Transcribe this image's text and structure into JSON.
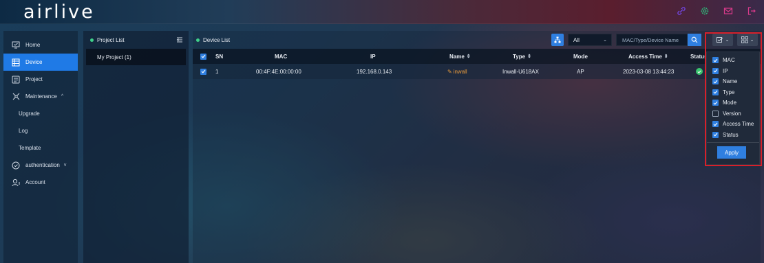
{
  "brand": {
    "logo_text": "airlive"
  },
  "topbar": {
    "icons": [
      "link-icon",
      "settings-icon",
      "mail-icon",
      "logout-icon"
    ],
    "icon_colors": {
      "link": "#7a4cff",
      "settings": "#2ec27e",
      "mail": "#d83a8a",
      "logout": "#d83a8a"
    }
  },
  "sidebar": {
    "items": [
      {
        "label": "Home",
        "icon": "monitor-icon"
      },
      {
        "label": "Device",
        "icon": "device-list-icon",
        "active": true
      },
      {
        "label": "Project",
        "icon": "project-icon"
      },
      {
        "label": "Maintenance",
        "icon": "maintenance-icon",
        "caret": "^"
      },
      {
        "label": "Upgrade"
      },
      {
        "label": "Log"
      },
      {
        "label": "Template"
      },
      {
        "label": "authentication",
        "icon": "shield-check-icon",
        "caret": "v"
      },
      {
        "label": "Account",
        "icon": "account-icon"
      }
    ]
  },
  "project_panel": {
    "title": "Project List",
    "projects": [
      "My Project (1)"
    ]
  },
  "device_panel": {
    "title": "Device List",
    "filter": {
      "selected": "All"
    },
    "search": {
      "placeholder": "MAC/Type/Device Name"
    },
    "table": {
      "headers": {
        "sn": "SN",
        "mac": "MAC",
        "ip": "IP",
        "name": "Name",
        "type": "Type",
        "mode": "Mode",
        "access_time": "Access Time",
        "status": "Status"
      },
      "rows": [
        {
          "sn": "1",
          "mac": "00:4F:4E:00:00:00",
          "ip": "192.168.0.143",
          "name": "inwall",
          "type": "Inwall-U618AX",
          "mode": "AP",
          "access_time": "2023-03-08 13:44:23",
          "status": "online"
        }
      ]
    }
  },
  "column_selector": {
    "options": [
      {
        "label": "MAC",
        "checked": true
      },
      {
        "label": "IP",
        "checked": true
      },
      {
        "label": "Name",
        "checked": true
      },
      {
        "label": "Type",
        "checked": true
      },
      {
        "label": "Mode",
        "checked": true
      },
      {
        "label": "Version",
        "checked": false
      },
      {
        "label": "Access Time",
        "checked": true
      },
      {
        "label": "Status",
        "checked": true
      }
    ],
    "apply_label": "Apply"
  },
  "colors": {
    "accent": "#1f7ae6",
    "highlight": "#d8202a",
    "status_online": "#39c46e",
    "link": "#e89a3c"
  }
}
